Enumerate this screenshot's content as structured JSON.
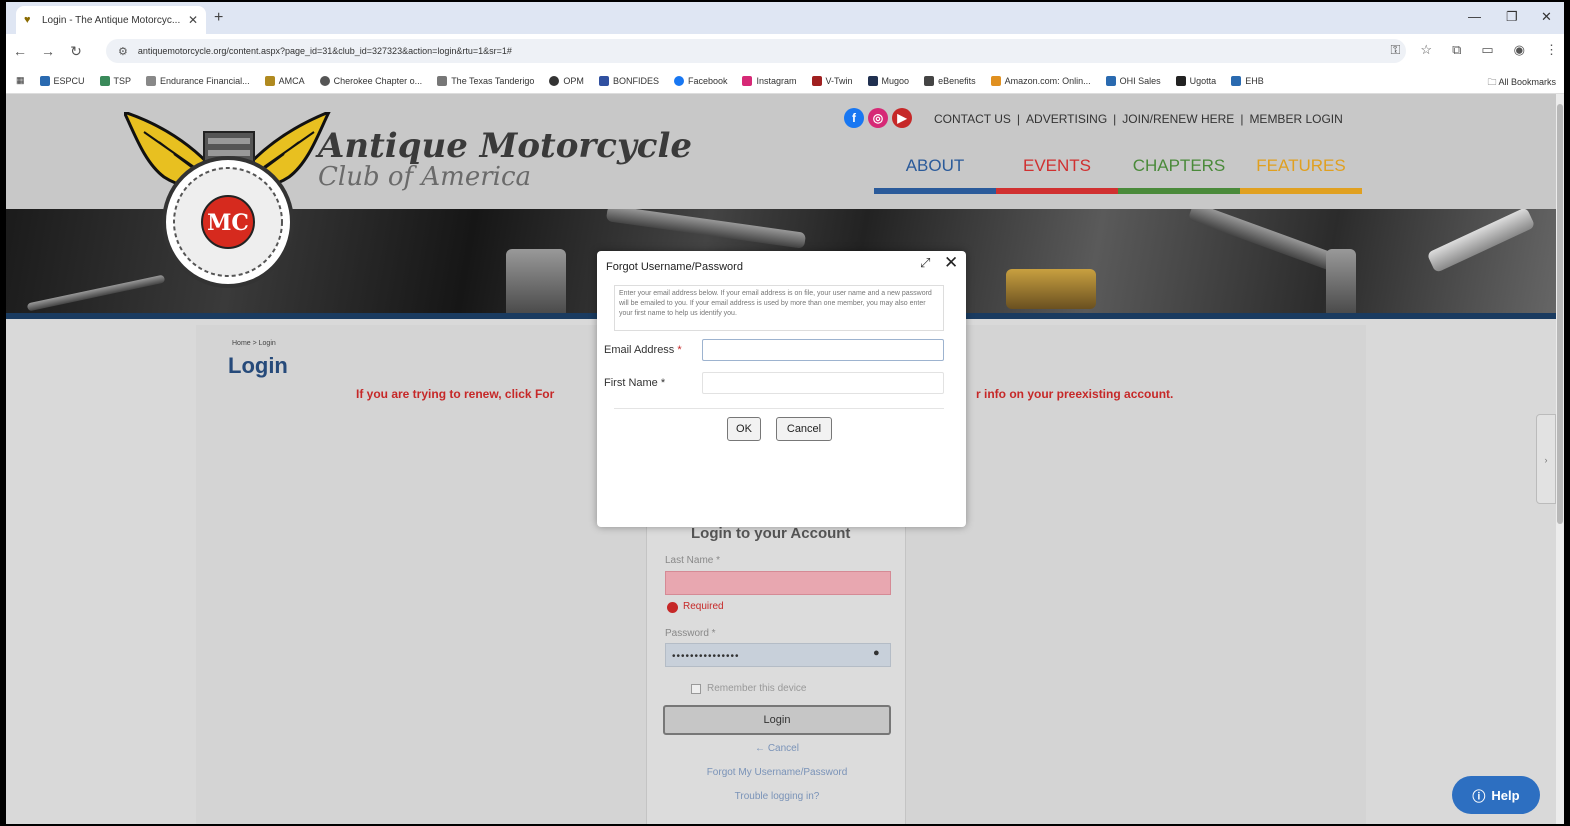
{
  "browser": {
    "tab_title": "Login - The Antique Motorcyc...",
    "url": "antiquemotorcycle.org/content.aspx?page_id=31&club_id=327323&action=login&rtu=1&sr=1#",
    "bookmarks": [
      "ESPCU",
      "TSP",
      "Endurance Financial...",
      "AMCA",
      "Cherokee Chapter o...",
      "The Texas Tanderigo",
      "OPM",
      "BONFIDES",
      "Facebook",
      "Instagram",
      "V-Twin",
      "Mugoo",
      "eBenefits",
      "Amazon.com: Onlin...",
      "OHI Sales",
      "Ugotta",
      "EHB"
    ],
    "all_bookmarks": "All Bookmarks"
  },
  "site": {
    "brand_line1": "Antique Motorcycle",
    "brand_line2": "Club of America",
    "logo_letters": "MC",
    "top_links": [
      "CONTACT US",
      "|",
      "ADVERTISING",
      "|",
      "JOIN/RENEW HERE",
      "|",
      "MEMBER LOGIN"
    ],
    "nav": [
      {
        "label": "ABOUT",
        "color": "#2a5a9a"
      },
      {
        "label": "EVENTS",
        "color": "#d03030"
      },
      {
        "label": "CHAPTERS",
        "color": "#4a8a3a"
      },
      {
        "label": "FEATURES",
        "color": "#e0a020"
      }
    ]
  },
  "page": {
    "breadcrumb": "Home > Login",
    "title": "Login",
    "notice_left": "If you are trying to renew, click For",
    "notice_right": "r info on your preexisting account."
  },
  "login": {
    "heading": "Login to your Account",
    "last_name_label": "Last Name *",
    "required_text": "Required",
    "password_label": "Password *",
    "password_mask": "•••••••••••••••",
    "remember_label": "Remember this device",
    "login_button": "Login",
    "cancel_link": "← Cancel",
    "forgot_link": "Forgot My Username/Password",
    "trouble_link": "Trouble logging in?"
  },
  "modal": {
    "title": "Forgot Username/Password",
    "info": "Enter your email address below. If your email address is on file, your user name and a new password will be emailed to you. If your email address is used by more than one member, you may also enter your first name to help us identify you.",
    "email_label": "Email Address",
    "first_name_label": "First Name",
    "required_mark": "*",
    "ok_label": "OK",
    "cancel_label": "Cancel"
  },
  "help": {
    "label": "Help"
  }
}
